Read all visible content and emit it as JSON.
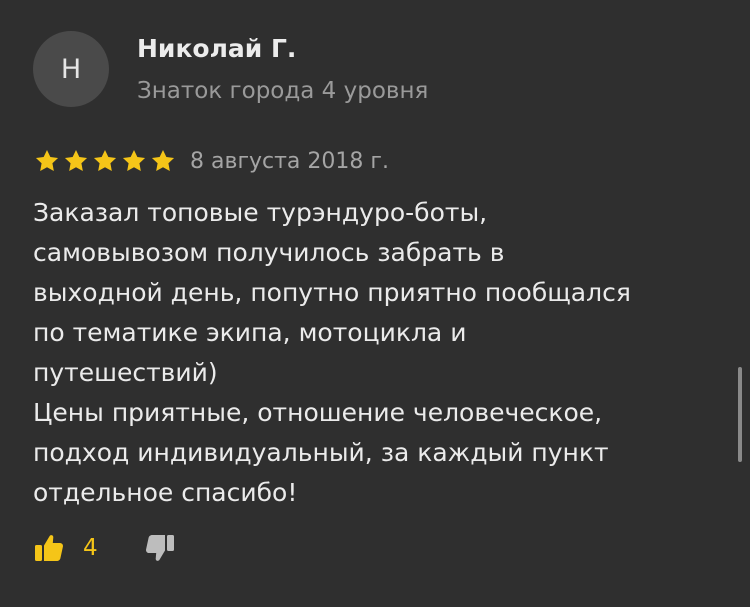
{
  "author": {
    "initial": "Н",
    "name": "Николай Г.",
    "level": "Знаток города 4 уровня"
  },
  "review": {
    "rating": 5,
    "date": "8 августа 2018 г.",
    "lines": [
      "Заказал топовые турэндуро-боты,",
      "самовывозом получилось забрать в",
      "выходной день, попутно приятно пообщался",
      "по тематике экипа, мотоцикла и",
      "путешествий)",
      "Цены приятные, отношение человеческое,",
      "подход индивидуальный, за каждый пункт",
      "отдельное спасибо!"
    ]
  },
  "reactions": {
    "likes": "4",
    "like_icon": "thumbs-up-icon",
    "dislike_icon": "thumbs-down-icon"
  },
  "colors": {
    "background": "#2f2f2f",
    "star": "#f5c518",
    "like_active": "#f5c518",
    "dislike": "#bdbdbd",
    "muted_text": "#9a9a9a"
  }
}
